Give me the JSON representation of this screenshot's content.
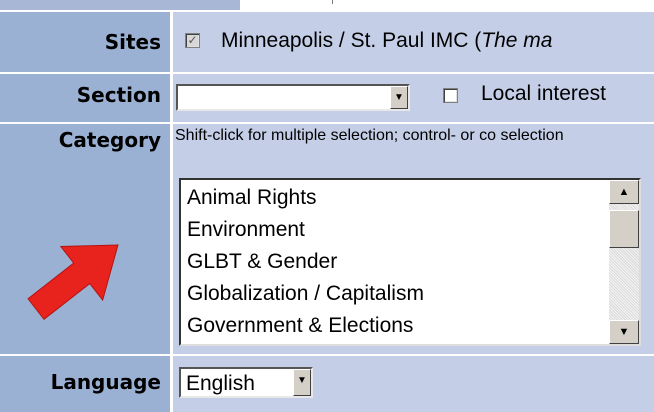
{
  "form": {
    "sites": {
      "label": "Sites",
      "checkbox_checked": true,
      "text_main": "Minneapolis / St. Paul IMC (",
      "text_italic": "The ma"
    },
    "section": {
      "label": "Section",
      "select_value": "",
      "local_interest_label": "Local interest",
      "local_interest_checked": false
    },
    "category": {
      "label": "Category",
      "hint": "Shift-click for multiple selection; control- or co selection",
      "options": [
        "Animal Rights",
        "Environment",
        "GLBT & Gender",
        "Globalization / Capitalism",
        "Government & Elections"
      ]
    },
    "language": {
      "label": "Language",
      "select_value": "English"
    }
  },
  "icons": {
    "checkmark": "✓",
    "dropdown": "▼",
    "scroll_up": "▲",
    "scroll_down": "▼",
    "pointer": "red-arrow-icon"
  },
  "colors": {
    "label_bg": "#9bb1d4",
    "field_bg": "#c4cfe7",
    "arrow": "#e8231e"
  }
}
